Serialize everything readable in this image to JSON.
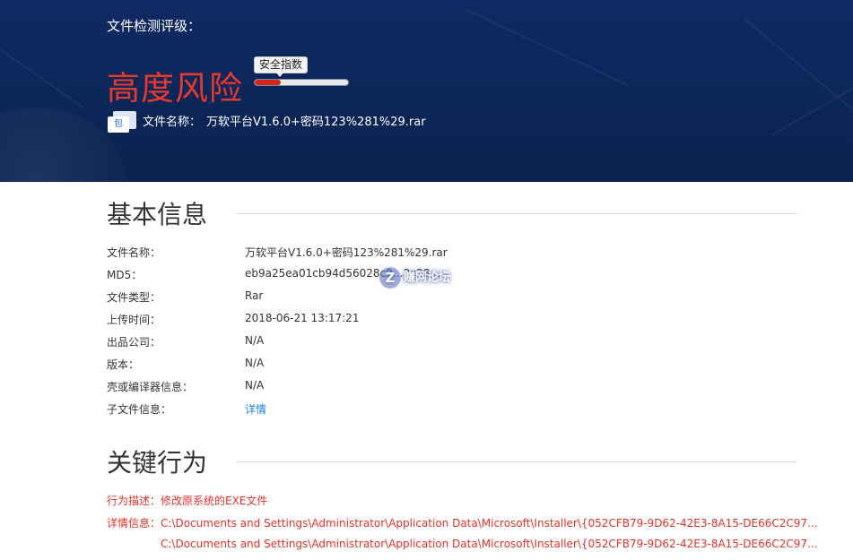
{
  "hero": {
    "rating_label": "文件检测评级：",
    "risk_level": "高度风险",
    "safety_tag": "安全指数",
    "safety_index_fraction": 0.28,
    "file_icon_text": "包",
    "file_label": "文件名称：",
    "file_name": "万软平台V1.6.0+密码123%281%29.rar",
    "colors": {
      "background": "#0b2657",
      "risk": "#e8392f",
      "bar_fill": "#d8261c"
    }
  },
  "basic_info": {
    "title": "基本信息",
    "rows": [
      {
        "key": "文件名称：",
        "value": "万软平台V1.6.0+密码123%281%29.rar"
      },
      {
        "key": "MD5：",
        "value": "eb9a25ea01cb94d56028c9…2c28…"
      },
      {
        "key": "文件类型：",
        "value": "Rar"
      },
      {
        "key": "上传时间：",
        "value": "2018-06-21 13:17:21"
      },
      {
        "key": "出品公司：",
        "value": "N/A"
      },
      {
        "key": "版本：",
        "value": "N/A"
      },
      {
        "key": "壳或编译器信息：",
        "value": "N/A"
      },
      {
        "key": "子文件信息：",
        "value": "详情"
      }
    ]
  },
  "watermark": {
    "glyph": "Z",
    "text": "赚网论坛"
  },
  "key_behavior": {
    "title": "关键行为",
    "description": "行为描述：修改原系统的EXE文件",
    "detail_label": "详情信息：",
    "details": [
      "C:\\Documents and Settings\\Administrator\\Application Data\\Microsoft\\Installer\\{052CFB79-9D62-42E3-8A15-DE66C2C97...",
      "C:\\Documents and Settings\\Administrator\\Application Data\\Microsoft\\Installer\\{052CFB79-9D62-42E3-8A15-DE66C2C97..."
    ],
    "color": "#e0332b"
  }
}
